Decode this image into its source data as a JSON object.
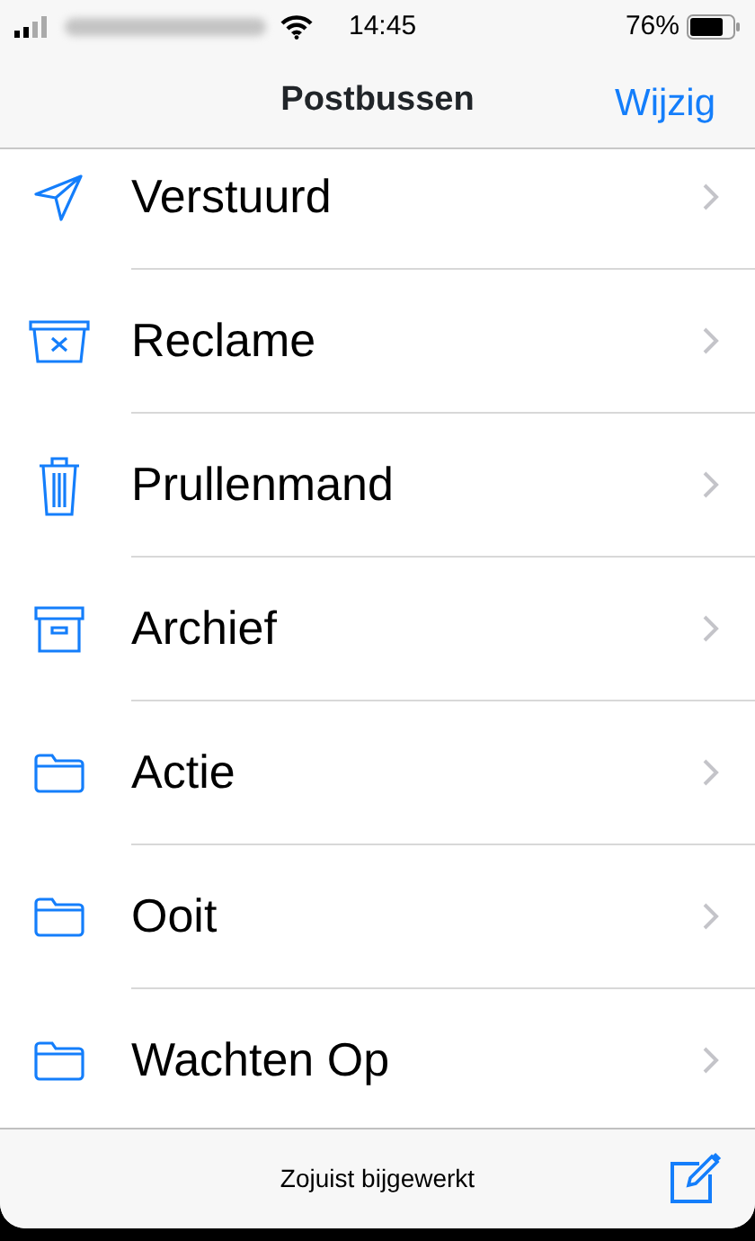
{
  "status_bar": {
    "time": "14:45",
    "battery": "76%"
  },
  "nav": {
    "title": "Postbussen",
    "action": "Wijzig"
  },
  "mailboxes": [
    {
      "kind": "sent",
      "label": "Verstuurd"
    },
    {
      "kind": "junk",
      "label": "Reclame"
    },
    {
      "kind": "trash",
      "label": "Prullenmand"
    },
    {
      "kind": "archive",
      "label": "Archief"
    },
    {
      "kind": "folder",
      "label": "Actie"
    },
    {
      "kind": "folder",
      "label": "Ooit"
    },
    {
      "kind": "folder",
      "label": "Wachten Op"
    }
  ],
  "toolbar": {
    "status": "Zojuist bijgewerkt"
  }
}
